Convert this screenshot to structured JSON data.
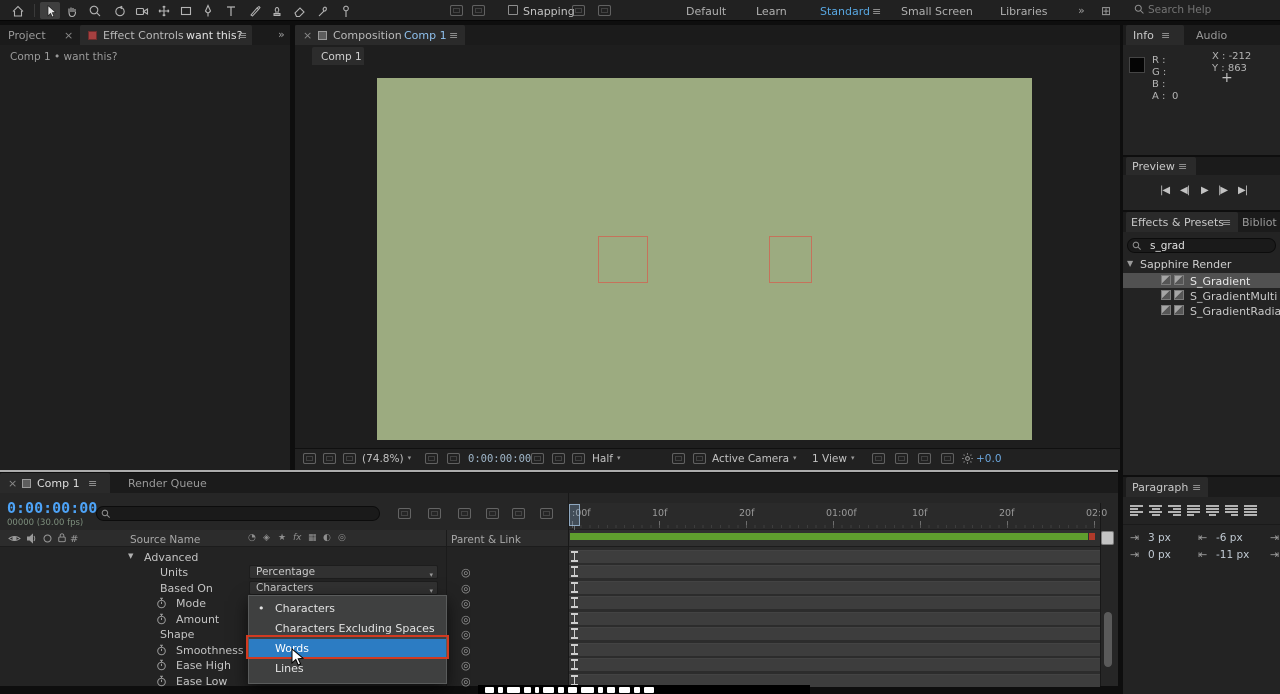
{
  "toolbar": {
    "snapping_label": "Snapping",
    "workspaces": [
      "Default",
      "Learn",
      "Standard",
      "Small Screen",
      "Libraries"
    ],
    "search_placeholder": "Search Help"
  },
  "glyphs": {
    "close": "×",
    "panel_menu": "≡",
    "overflow": "»",
    "chevron_down": "▾",
    "twirl_open": "▼",
    "bullet": "•",
    "pick_whip": "◎",
    "crosshair": "+",
    "grid": "⊞",
    "transport": [
      "|◀",
      "◀|",
      "▶",
      "|▶",
      "▶|"
    ],
    "switch_icons": [
      "◔",
      "◈",
      "★",
      "fx",
      "▦",
      "◐",
      "◎"
    ],
    "indent_left": "⇥",
    "indent_right": "⇤"
  },
  "left_panel": {
    "project_tab": "Project",
    "effect_controls_tab": "Effect Controls",
    "layer_name": "want this?",
    "context_line": "Comp 1 • want this?"
  },
  "comp_panel": {
    "panel_tab_prefix": "Composition",
    "panel_tab_comp": "Comp 1",
    "viewer_tab": "Comp 1",
    "zoom_value": "(74.8%)",
    "timecode": "0:00:00:00",
    "resolution_value": "Half",
    "camera_value": "Active Camera",
    "view_value": "1 View",
    "exposure_value": "+0.0"
  },
  "info_panel": {
    "tab": "Info",
    "audio_tab": "Audio",
    "r_label": "R :",
    "g_label": "G :",
    "b_label": "B :",
    "a_label": "A :",
    "a_value": "0",
    "x_value": "X : -212",
    "y_value": "Y : 863"
  },
  "preview_panel": {
    "title": "Preview"
  },
  "effects_panel": {
    "title": "Effects & Presets",
    "neighbor_tab": "Bibliot",
    "search_value": "s_grad",
    "group_label": "Sapphire Render",
    "items": [
      "S_Gradient",
      "S_GradientMulti",
      "S_GradientRadial"
    ]
  },
  "paragraph_panel": {
    "title": "Paragraph",
    "left_values": [
      "3 px",
      "0 px"
    ],
    "right_values": [
      "-6 px",
      "-11 px"
    ]
  },
  "timeline": {
    "comp_tab": "Comp 1",
    "render_queue_tab": "Render Queue",
    "timecode": "0:00:00:00",
    "frames_info": "00000 (30.00 fps)",
    "hash_col": "#",
    "source_name_col": "Source Name",
    "parent_link_col": "Parent & Link",
    "ruler_ticks": [
      ":00f",
      "10f",
      "20f",
      "01:00f",
      "10f",
      "20f",
      "02:0"
    ],
    "properties": [
      {
        "label": "Advanced",
        "value": ""
      },
      {
        "label": "Units",
        "value": "Percentage"
      },
      {
        "label": "Based On",
        "value": "Characters"
      },
      {
        "label": "Mode",
        "value": ""
      },
      {
        "label": "Amount",
        "value": ""
      },
      {
        "label": "Shape",
        "value": ""
      },
      {
        "label": "Smoothness",
        "value": ""
      },
      {
        "label": "Ease High",
        "value": ""
      },
      {
        "label": "Ease Low",
        "value": ""
      }
    ],
    "based_on_menu": {
      "items": [
        "Characters",
        "Characters Excluding Spaces",
        "Words",
        "Lines"
      ],
      "checked_item": "Characters",
      "highlighted_item": "Words"
    }
  },
  "colors": {
    "accent_blue": "#4da3f7",
    "menu_highlight": "#2c7cc3",
    "annotation_red": "#d23a21",
    "canvas_green": "#9cab80",
    "cache_green": "#5f9e2e"
  }
}
